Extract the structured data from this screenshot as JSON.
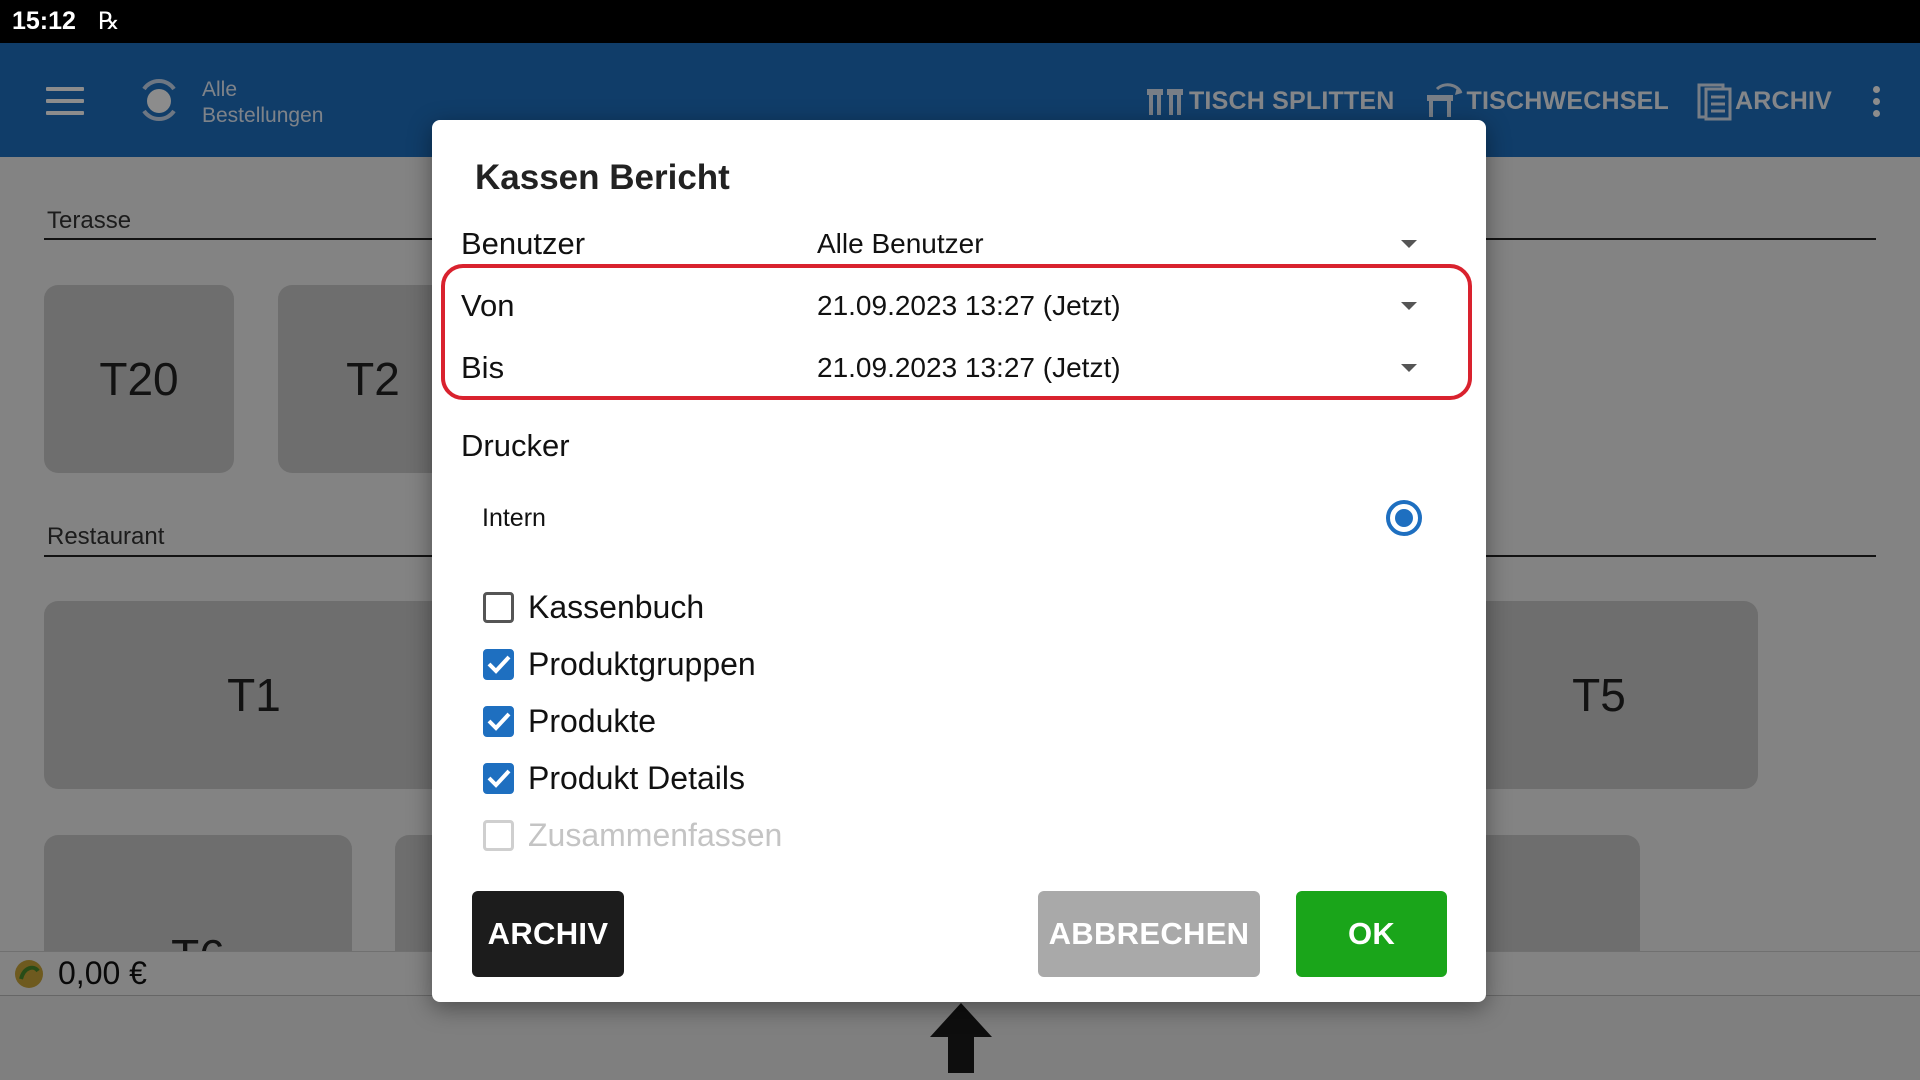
{
  "status_bar": {
    "time": "15:12",
    "notification_icon": "swipe-icon"
  },
  "app_bar": {
    "title_line1": "Alle",
    "title_line2": "Bestellungen",
    "actions": [
      {
        "label": "TISCH SPLITTEN",
        "icon": "table-split-icon"
      },
      {
        "label": "TISCHWECHSEL",
        "icon": "table-change-icon"
      },
      {
        "label": "ARCHIV",
        "icon": "archive-icon"
      }
    ]
  },
  "sections": {
    "terasse": "Terasse",
    "restaurant": "Restaurant"
  },
  "tables": {
    "t20": "T20",
    "t2": "T2",
    "t1": "T1",
    "t5": "T5",
    "t6": "T6"
  },
  "bottom": {
    "amount": "0,00 €"
  },
  "dialog": {
    "title": "Kassen Bericht",
    "user_label": "Benutzer",
    "user_value": "Alle Benutzer",
    "from_label": "Von",
    "from_value": "21.09.2023 13:27 (Jetzt)",
    "to_label": "Bis",
    "to_value": "21.09.2023 13:27 (Jetzt)",
    "printer_label": "Drucker",
    "printer_option": "Intern",
    "printer_selected": true,
    "checkboxes": [
      {
        "label": "Kassenbuch",
        "checked": false,
        "enabled": true
      },
      {
        "label": "Produktgruppen",
        "checked": true,
        "enabled": true
      },
      {
        "label": "Produkte",
        "checked": true,
        "enabled": true
      },
      {
        "label": "Produkt Details",
        "checked": true,
        "enabled": true
      },
      {
        "label": "Zusammenfassen",
        "checked": false,
        "enabled": false
      }
    ],
    "buttons": {
      "archiv": "ARCHIV",
      "cancel": "ABBRECHEN",
      "ok": "OK"
    }
  },
  "colors": {
    "primary": "#1e6fc0",
    "ok_green": "#1aa51a",
    "highlight_red": "#d9222e"
  }
}
